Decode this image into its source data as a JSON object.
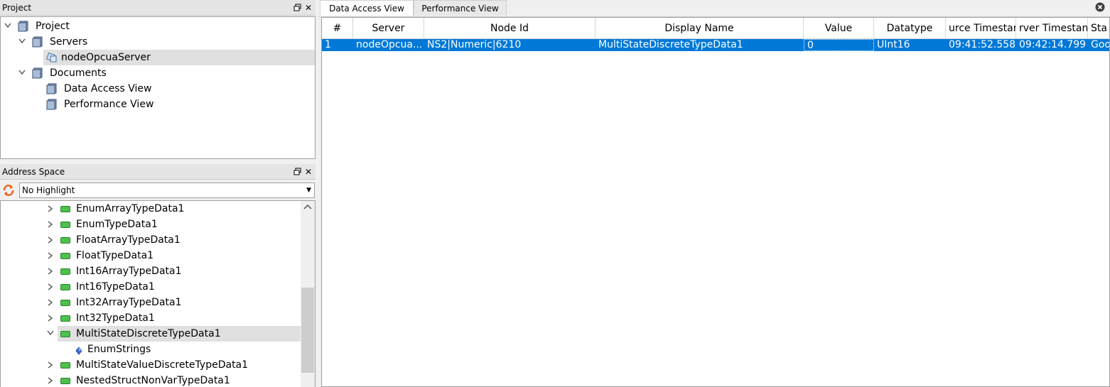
{
  "project_panel": {
    "title": "Project",
    "tree": [
      {
        "label": "Project"
      },
      {
        "label": "Servers"
      },
      {
        "label": "nodeOpcuaServer"
      },
      {
        "label": "Documents"
      },
      {
        "label": "Data Access View"
      },
      {
        "label": "Performance View"
      }
    ]
  },
  "address_panel": {
    "title": "Address Space",
    "highlight_select": "No Highlight",
    "items": [
      {
        "label": "EnumArrayTypeData1"
      },
      {
        "label": "EnumTypeData1"
      },
      {
        "label": "FloatArrayTypeData1"
      },
      {
        "label": "FloatTypeData1"
      },
      {
        "label": "Int16ArrayTypeData1"
      },
      {
        "label": "Int16TypeData1"
      },
      {
        "label": "Int32ArrayTypeData1"
      },
      {
        "label": "Int32TypeData1"
      },
      {
        "label": "MultiStateDiscreteTypeData1"
      },
      {
        "label": "EnumStrings"
      },
      {
        "label": "MultiStateValueDiscreteTypeData1"
      },
      {
        "label": "NestedStructNonVarTypeData1"
      }
    ]
  },
  "tabs": [
    "Data Access View",
    "Performance View"
  ],
  "grid": {
    "columns": [
      "#",
      "Server",
      "Node Id",
      "Display Name",
      "Value",
      "Datatype",
      "urce Timestar",
      "rver Timestan",
      "Sta"
    ],
    "rows": [
      [
        "1",
        "nodeOpcua...",
        "NS2|Numeric|6210",
        "MultiStateDiscreteTypeData1",
        "0",
        "UInt16",
        "09:41:52.558",
        "09:42:14.799",
        "Goo"
      ]
    ]
  },
  "colors": {
    "selection": "#0078d7",
    "tree_selection": "#e0e0e0",
    "tag_green": "#4cc24c"
  }
}
